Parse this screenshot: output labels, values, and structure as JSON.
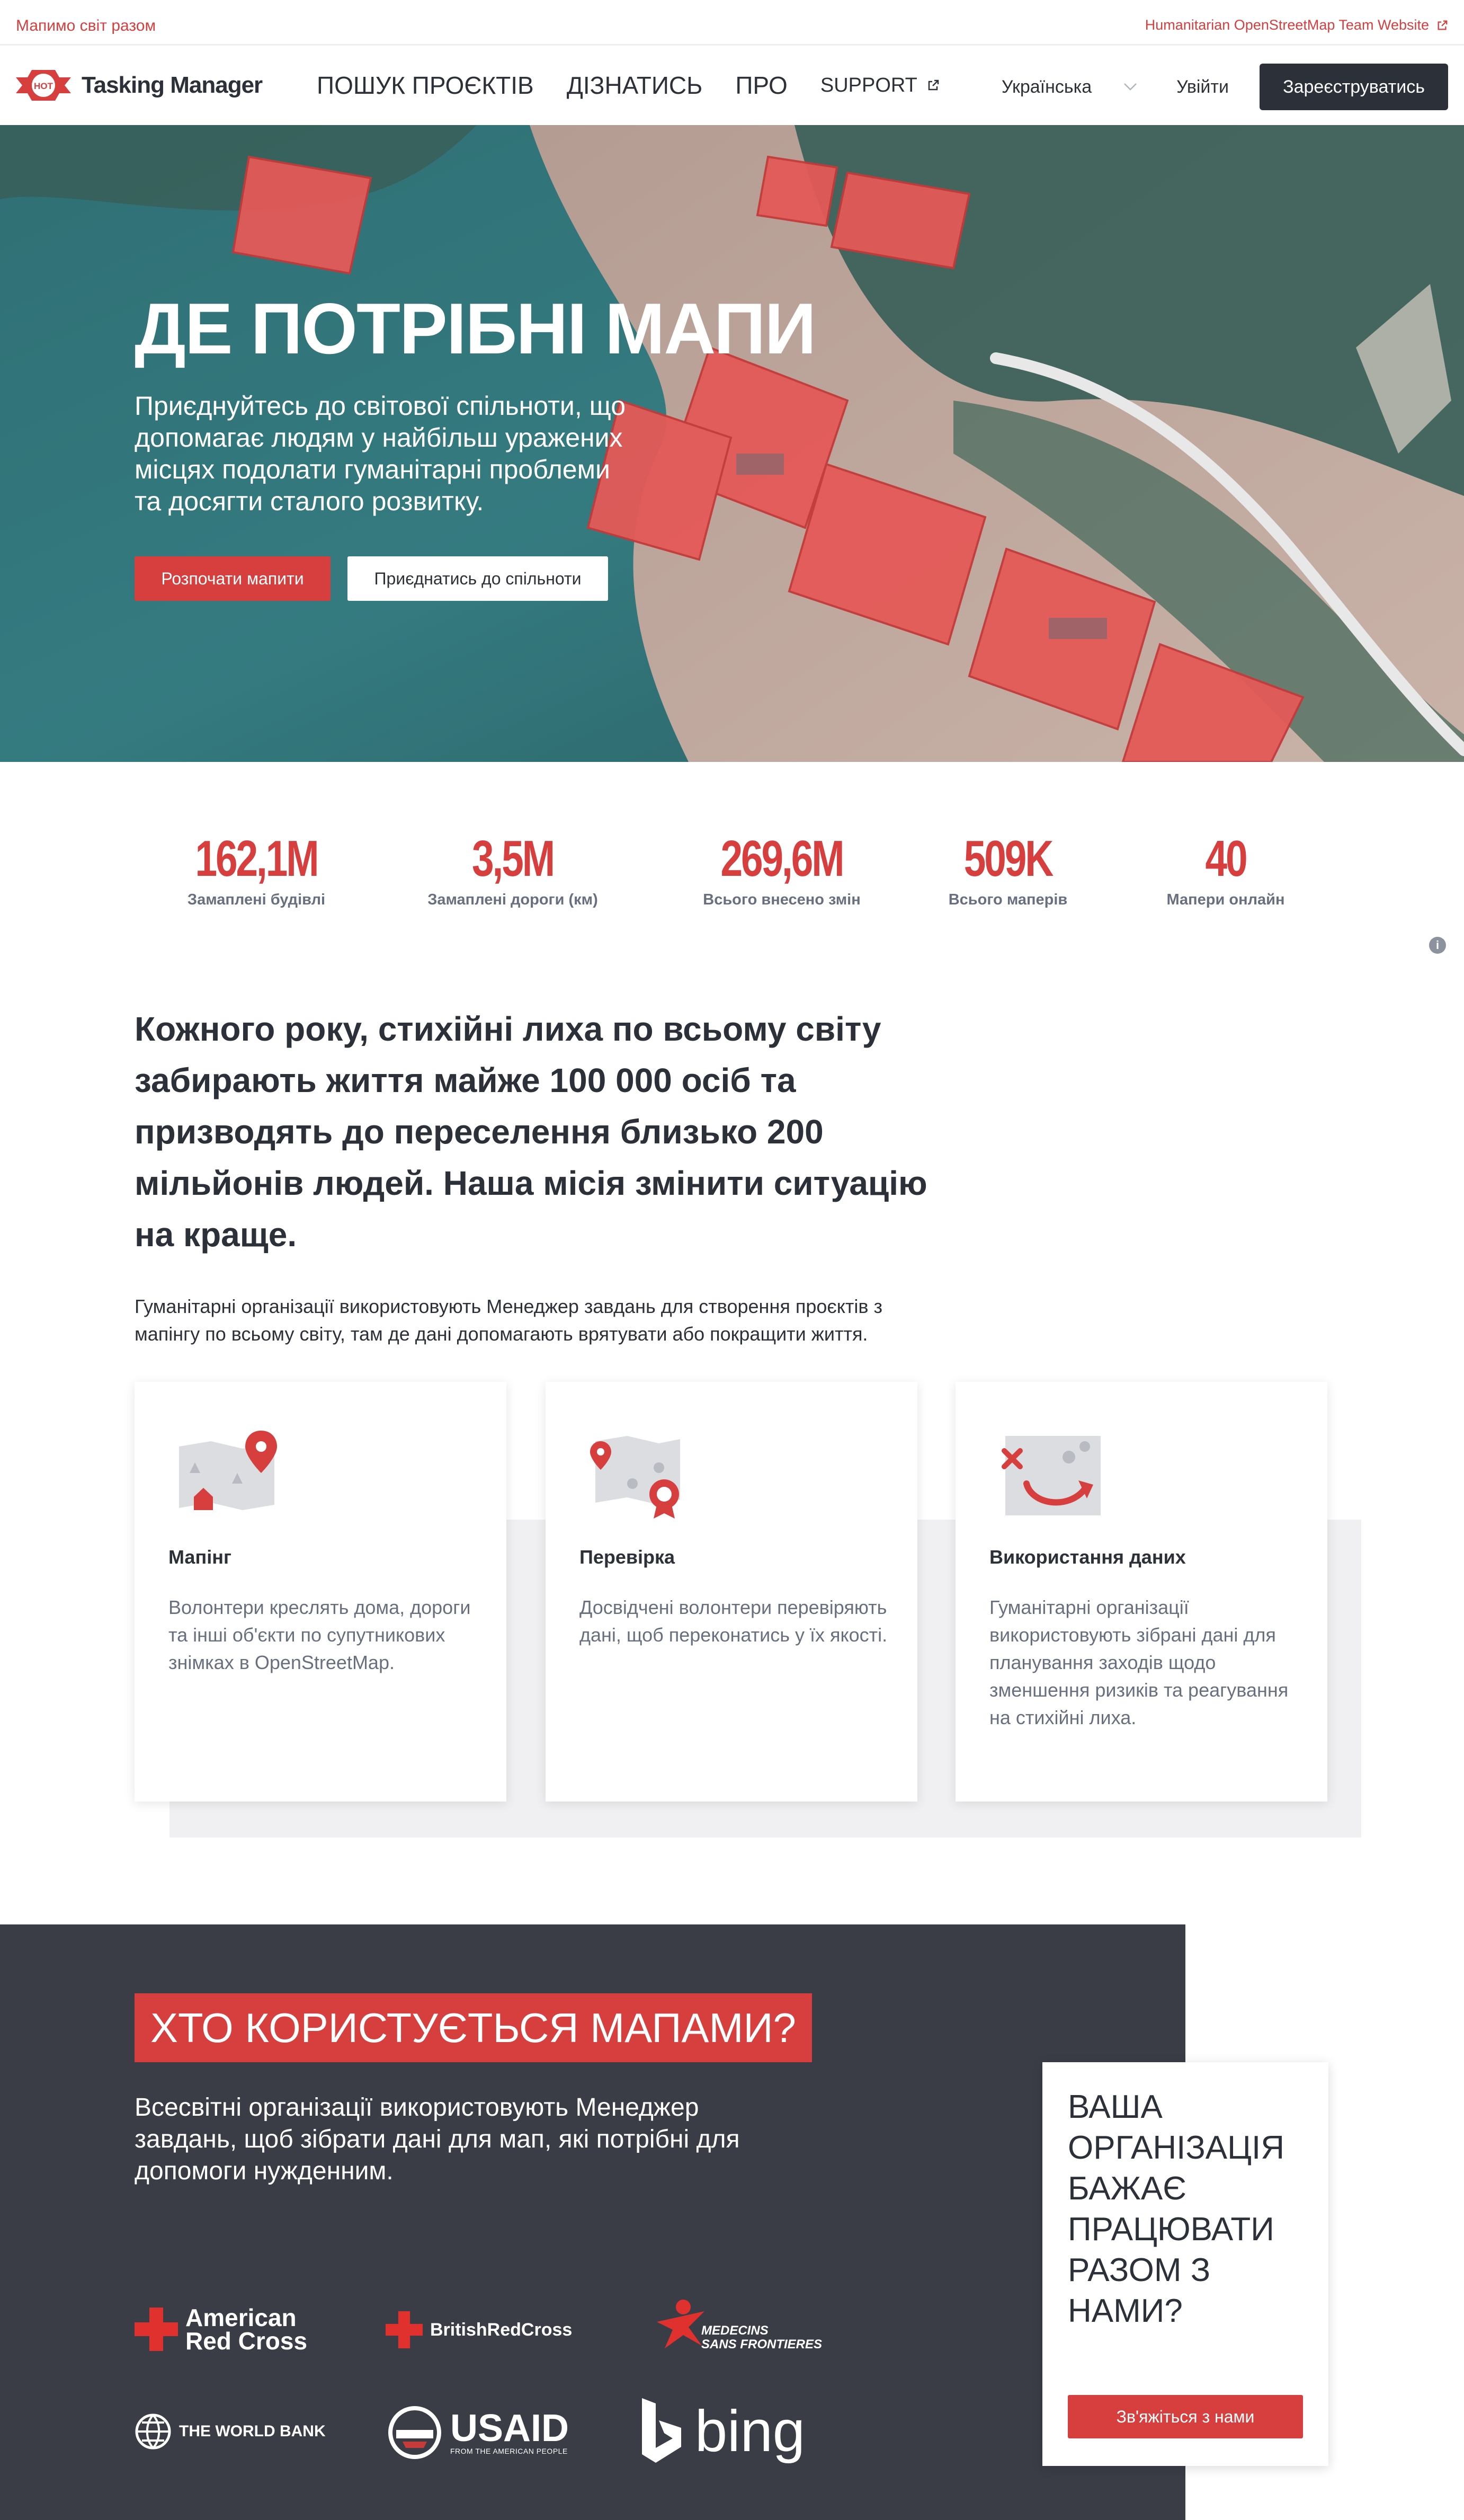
{
  "topbar": {
    "left_text": "Мапимо світ разом",
    "right_link": "Humanitarian OpenStreetMap Team Website"
  },
  "nav": {
    "logo_badge": "HOT",
    "logo_text": "Tasking Manager",
    "menu": [
      "ПОШУК ПРОЄКТІВ",
      "ДІЗНАТИСЬ",
      "ПРО"
    ],
    "support": "SUPPORT",
    "language": "Українська",
    "login": "Увійти",
    "signup": "Зареєструватись"
  },
  "hero": {
    "title": "ДЕ ПОТРІБНІ МАПИ",
    "text": "Приєднуйтесь до світової спільноти, що допомагає людям у найбільш уражених місцях подолати гуманітарні проблеми та досягти сталого розвитку.",
    "primary_button": "Розпочати мапити",
    "secondary_button": "Приєднатись до спільноти"
  },
  "stats": [
    {
      "value": "162,1M",
      "label": "Замаплені будівлі"
    },
    {
      "value": "3,5M",
      "label": "Замаплені дороги (км)"
    },
    {
      "value": "269,6M",
      "label": "Всього внесено змін"
    },
    {
      "value": "509K",
      "label": "Всього маперів"
    },
    {
      "value": "40",
      "label": "Мапери онлайн"
    }
  ],
  "mission": {
    "headline": "Кожного року, стихійні лиха по всьому світу забирають життя майже 100 000 осіб та призводять до переселення близько 200 мільйонів людей. Наша місія змінити ситуацію на краще.",
    "subtext": "Гуманітарні організації використовують Менеджер завдань для створення проєктів з мапінгу по всьому світу, там де дані допомагають врятувати або покращити життя."
  },
  "cards": [
    {
      "title": "Мапінг",
      "text": "Волонтери креслять дома, дороги та інші об'єкти по супутникових знімках в OpenStreetMap.",
      "icon": "map-pin-icon"
    },
    {
      "title": "Перевірка",
      "text": "Досвідчені волонтери перевіряють дані, щоб переконатись у їх якості.",
      "icon": "map-badge-icon"
    },
    {
      "title": "Використання даних",
      "text": "Гуманітарні організації використовують зібрані дані для планування заходів щодо зменшення ризиків та реагування на стихійні лиха.",
      "icon": "data-route-icon"
    }
  ],
  "who": {
    "title": "ХТО КОРИСТУЄТЬСЯ МАПАМИ?",
    "text": "Всесвітні організації використовують Менеджер завдань, щоб зібрати дані для мап, які потрібні для допомоги нужденним.",
    "partners": {
      "american_red_cross": [
        "American",
        "Red Cross"
      ],
      "british_red_cross": "BritishRedCross",
      "msf": [
        "MEDECINS",
        "SANS FRONTIERES"
      ],
      "world_bank": "THE WORLD BANK",
      "usaid": "USAID",
      "usaid_sub": "FROM THE AMERICAN PEOPLE",
      "bing": "bing"
    }
  },
  "cta": {
    "title": "Ваша організація бажає працювати разом з нами?",
    "button": "Зв'яжіться з нами"
  },
  "colors": {
    "accent": "#d73f3f",
    "dark": "#2c3038",
    "section_dark": "#3a3d46",
    "muted": "#68707f"
  }
}
